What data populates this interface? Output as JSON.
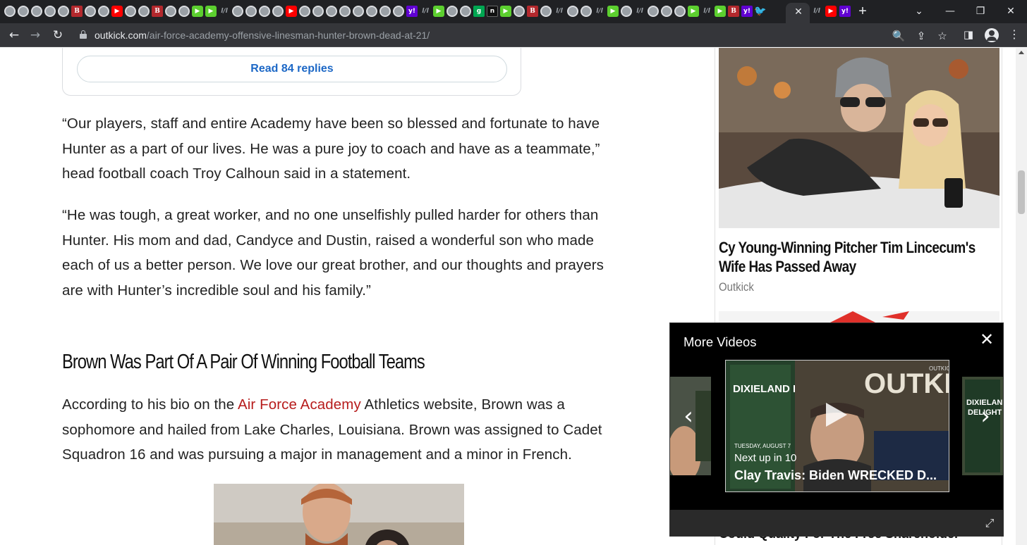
{
  "browser": {
    "tab_favicons": [
      "g",
      "g",
      "g",
      "g",
      "g",
      "bi",
      "g",
      "g",
      "yt",
      "g",
      "g",
      "bi",
      "g",
      "g",
      "play",
      "play",
      "dim",
      "g",
      "g",
      "g",
      "g",
      "yt",
      "g",
      "g",
      "g",
      "g",
      "g",
      "g",
      "g",
      "g",
      "yh",
      "dim",
      "play",
      "g",
      "g",
      "grn",
      "blk",
      "play",
      "g",
      "bi",
      "g",
      "dim",
      "g",
      "g",
      "dim",
      "play",
      "g",
      "dim",
      "g",
      "g",
      "g",
      "play",
      "dim",
      "play",
      "bi",
      "yh",
      "tw"
    ],
    "tab_favicon_glyphs": {
      "bi": "B",
      "yt": "▶",
      "play": "▶",
      "yh": "y!",
      "grn": "g",
      "blk": "n",
      "tw": "🐦",
      "dim": "l/l"
    },
    "active_tab_close": "✕",
    "tail_favicons": [
      "dim",
      "yt",
      "yh"
    ],
    "new_tab": "+",
    "window_controls": {
      "chevron": "⌄",
      "minimize": "—",
      "maximize": "❐",
      "close": "✕"
    },
    "nav": {
      "back": "←",
      "forward": "→",
      "reload": "↻"
    },
    "url_host": "outkick.com",
    "url_path": "/air-force-academy-offensive-linesman-hunter-brown-dead-at-21/",
    "omni_icons": {
      "zoom": "🔍",
      "share": "⇪",
      "bookmark": "☆",
      "sidepanel": "◨"
    }
  },
  "article": {
    "replies_button": "Read 84 replies",
    "quote1_lines": [
      "“Our players, staff and entire Academy have been so blessed and fortunate to have",
      "Hunter as a part of our lives. He was a pure joy to coach and have as a teammate,”",
      "head football coach Troy Calhoun said in a statement."
    ],
    "quote2_lines": [
      "“He was tough, a great worker, and no one unselfishly pulled harder for others than",
      "Hunter. His mom and dad, Candyce and Dustin, raised a wonderful son who made",
      "each of us a better person. We love our great brother, and our thoughts and prayers",
      "are with Hunter’s incredible soul and his family.”"
    ],
    "heading": "Brown Was Part Of A Pair Of Winning Football Teams",
    "bio": {
      "before_link": "According to his bio on the ",
      "link": "Air Force Academy",
      "after_link": " Athletics website, Brown was a",
      "line2": "sophomore and hailed from Lake Charles, Louisiana. Brown was assigned to Cadet",
      "line3": "Squadron 16 and was pursuing a major in management and a minor in French."
    }
  },
  "sidebar": {
    "promo_title": "Cy Young-Winning Pitcher Tim Lincecum's Wife Has Passed Away",
    "promo_source": "Outkick",
    "next_promo_title": "Could Quality For The Free Shareholder"
  },
  "video": {
    "title": "More Videos",
    "close": "✕",
    "prev_arrow": "‹",
    "next_arrow": "›",
    "next_up": "Next up in 10",
    "next_title": "Clay Travis: Biden WRECKED D...",
    "thumb_brand": "OUTKICK",
    "thumb_brand_small": "OUTKICK",
    "thumb_show": "DIXIELAND DELIGHT",
    "thumb_date": "TUESDAY, AUGUST 7",
    "expand": "⤢"
  }
}
